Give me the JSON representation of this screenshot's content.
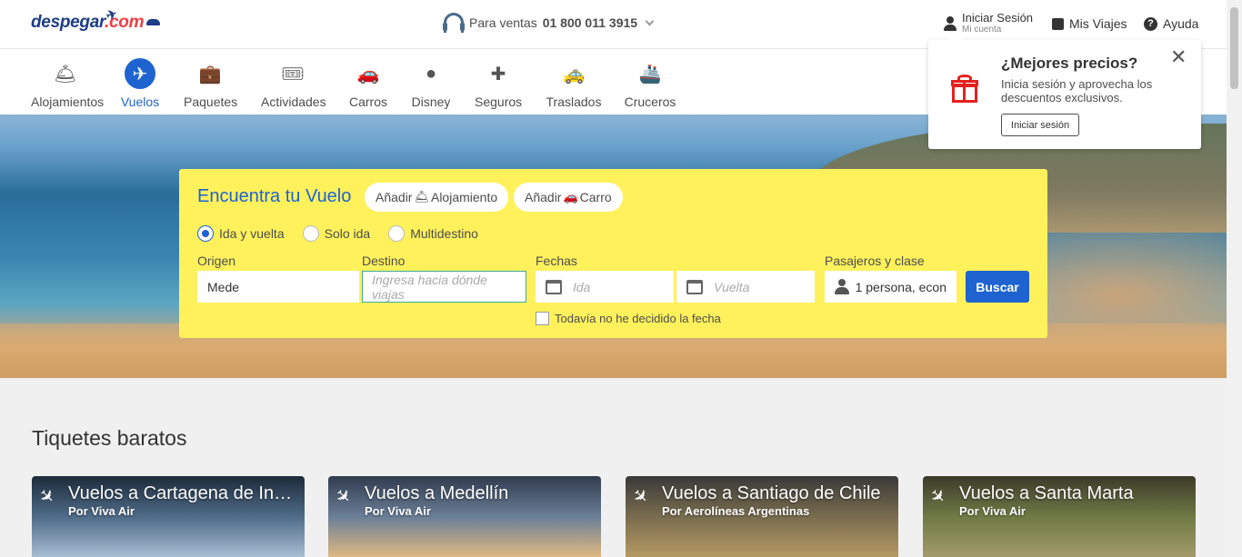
{
  "header": {
    "logo": {
      "text_main": "despegar",
      "text_accent": ".com"
    },
    "phone": {
      "label": "Para ventas",
      "number": "01 800 011 3915"
    },
    "account": {
      "label": "Iniciar Sesión",
      "sub": "Mi cuenta"
    },
    "trips": {
      "label": "Mis Viajes"
    },
    "help": {
      "label": "Ayuda"
    }
  },
  "products": [
    {
      "label": "Alojamientos",
      "icon": "hotel-bell-icon"
    },
    {
      "label": "Vuelos",
      "icon": "plane-icon",
      "active": true
    },
    {
      "label": "Paquetes",
      "icon": "suitcase-icon"
    },
    {
      "label": "Actividades",
      "icon": "tickets-icon"
    },
    {
      "label": "Carros",
      "icon": "car-icon"
    },
    {
      "label": "Disney",
      "icon": "mickey-icon"
    },
    {
      "label": "Seguros",
      "icon": "medical-case-icon"
    },
    {
      "label": "Traslados",
      "icon": "taxi-icon"
    },
    {
      "label": "Cruceros",
      "icon": "ship-icon"
    }
  ],
  "search": {
    "title": "Encuentra tu Vuelo",
    "add_hotel": {
      "prefix": "Añadir",
      "label": "Alojamiento"
    },
    "add_car": {
      "prefix": "Añadir",
      "label": "Carro"
    },
    "trip_types": [
      "Ida y vuelta",
      "Solo ida",
      "Multidestino"
    ],
    "selected_trip_type": "Ida y vuelta",
    "origin": {
      "label": "Origen",
      "value": "Mede"
    },
    "destination": {
      "label": "Destino",
      "placeholder": "Ingresa hacia dónde viajas"
    },
    "dates": {
      "label": "Fechas",
      "depart_placeholder": "Ida",
      "return_placeholder": "Vuelta"
    },
    "passengers": {
      "label": "Pasajeros y clase",
      "value": "1 persona, econ"
    },
    "submit_label": "Buscar",
    "undecided_label": "Todavía no he decidido la fecha"
  },
  "popup": {
    "title": "¿Mejores precios?",
    "text": "Inicia sesión y aprovecha los descuentos exclusivos.",
    "button": "Iniciar sesión",
    "close": "✕"
  },
  "deals": {
    "title": "Tiquetes baratos",
    "cards": [
      {
        "title": "Vuelos a Cartagena de Indias",
        "sub": "Por Viva Air"
      },
      {
        "title": "Vuelos a Medellín",
        "sub": "Por Viva Air"
      },
      {
        "title": "Vuelos a Santiago de Chile",
        "sub": "Por Aerolíneas Argentinas"
      },
      {
        "title": "Vuelos a Santa Marta",
        "sub": "Por Viva Air"
      }
    ]
  },
  "colors": {
    "brand_blue": "#1e63d0",
    "search_yellow": "#fff15c",
    "gift_red": "#e5211f"
  }
}
